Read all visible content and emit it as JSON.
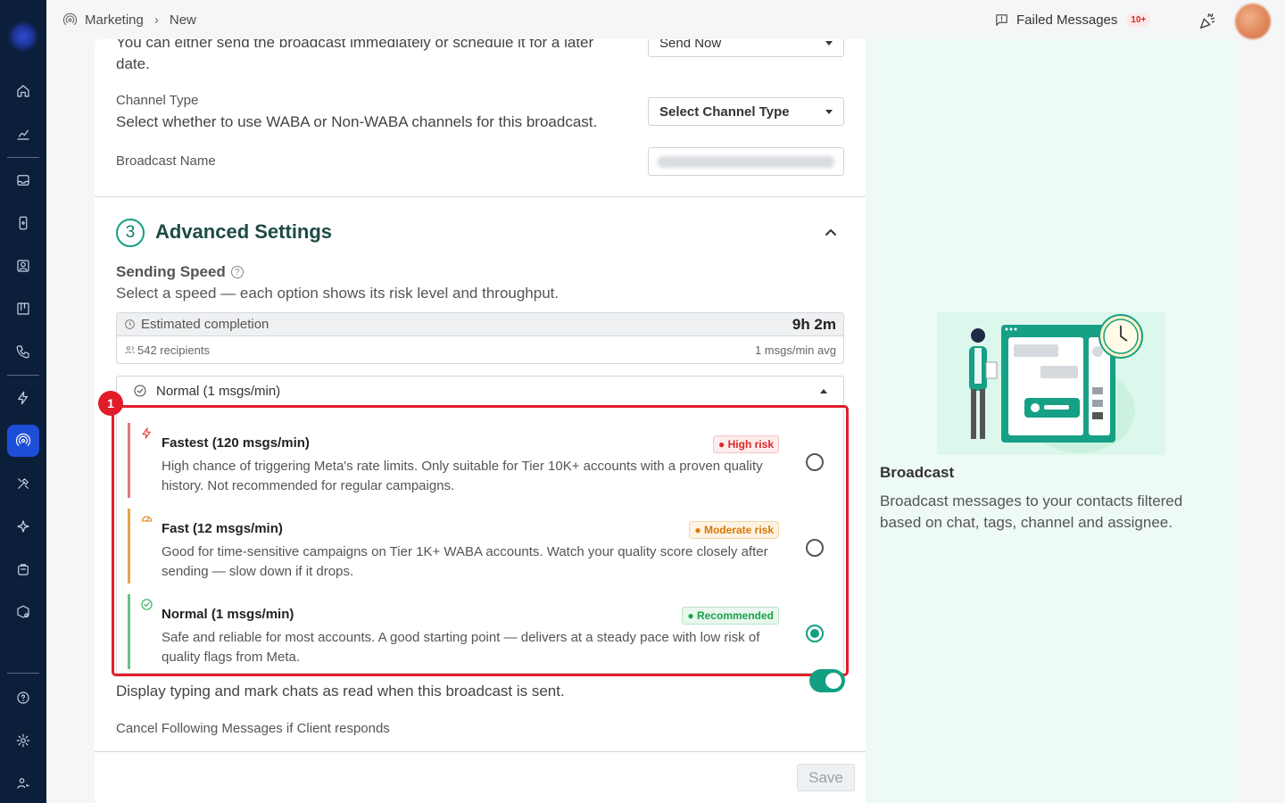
{
  "breadcrumb": {
    "section": "Marketing",
    "page": "New"
  },
  "header": {
    "failed_label": "Failed Messages",
    "failed_badge": "10+"
  },
  "form": {
    "schedule_desc_line1": "You can either send the broadcast immediately or schedule it for a later",
    "schedule_desc_line2": "date.",
    "schedule_value": "Send Now",
    "channel_label": "Channel Type",
    "channel_desc": "Select whether to use WABA or Non-WABA channels for this broadcast.",
    "channel_placeholder": "Select Channel Type",
    "name_label": "Broadcast Name"
  },
  "advanced": {
    "number": "3",
    "title": "Advanced Settings",
    "speed_label": "Sending Speed",
    "speed_desc": "Select a speed — each option shows its risk level and throughput.",
    "estimate_label": "Estimated completion",
    "estimate_value": "9h 2m",
    "recipients": "542 recipients",
    "avg": "1 msgs/min avg",
    "selected_speed": "Normal (1 msgs/min)",
    "options": [
      {
        "title": "Fastest (120 msgs/min)",
        "tag": "High risk",
        "desc": "High chance of triggering Meta's rate limits. Only suitable for Tier 10K+ accounts with a proven quality history. Not recommended for regular campaigns."
      },
      {
        "title": "Fast (12 msgs/min)",
        "tag": "Moderate risk",
        "desc": "Good for time-sensitive campaigns on Tier 1K+ WABA accounts. Watch your quality score closely after sending — slow down if it drops."
      },
      {
        "title": "Normal (1 msgs/min)",
        "tag": "Recommended",
        "desc": "Safe and reliable for most accounts. A good starting point — delivers at a steady pace with low risk of quality flags from Meta."
      }
    ],
    "selected_index": 2,
    "typing_desc": "Display typing and mark chats as read when this broadcast is sent.",
    "cancel_label": "Cancel Following Messages if Client responds"
  },
  "footer": {
    "save_label": "Save"
  },
  "annotation": {
    "number": "1"
  },
  "info": {
    "title": "Broadcast",
    "desc": "Broadcast messages to your contacts filtered based on chat, tags, channel and assignee."
  },
  "colors": {
    "accent": "#12a083",
    "high_risk": "#dc2626",
    "moderate_risk": "#d97706",
    "recommended": "#16a34a",
    "sidebar": "#0b1f3a",
    "highlight": "#e11d2a"
  }
}
